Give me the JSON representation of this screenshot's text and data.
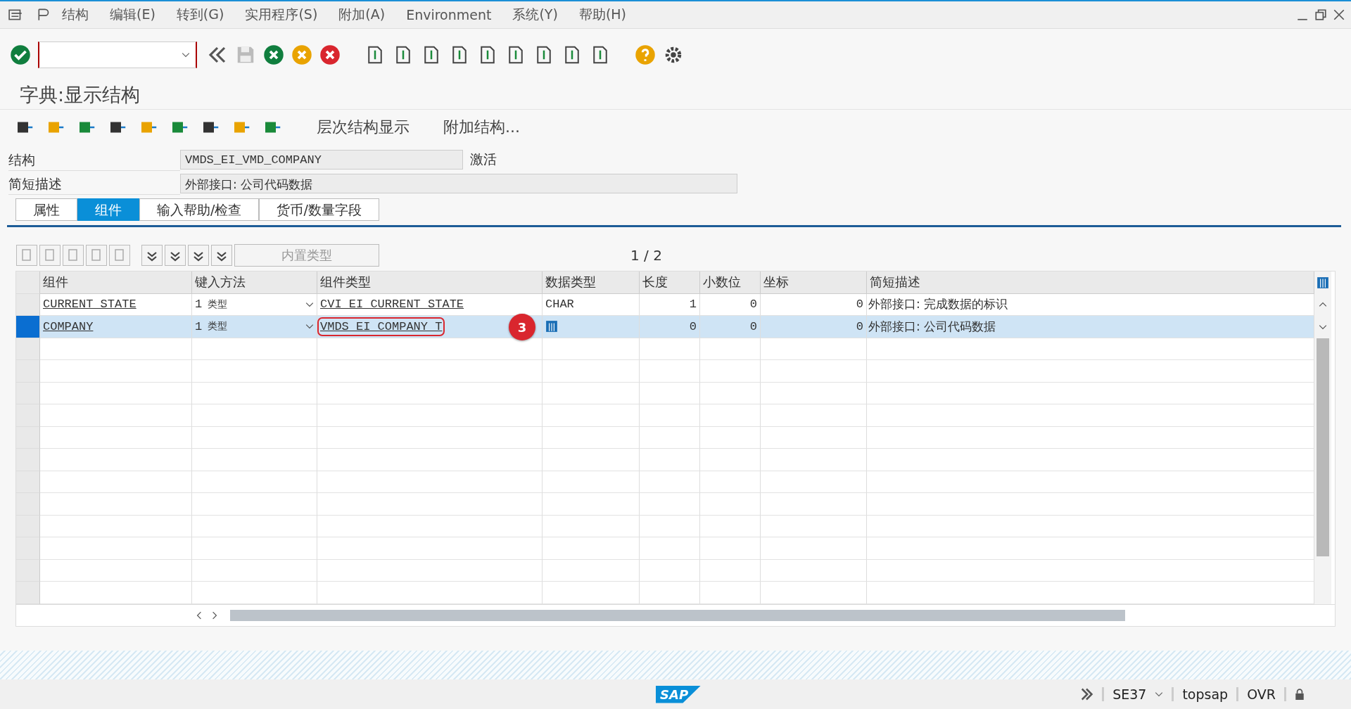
{
  "menu": [
    {
      "label": "结构"
    },
    {
      "label": "编辑(E)"
    },
    {
      "label": "转到(G)"
    },
    {
      "label": "实用程序(S)"
    },
    {
      "label": "附加(A)"
    },
    {
      "label": "Environment"
    },
    {
      "label": "系统(Y)"
    },
    {
      "label": "帮助(H)"
    }
  ],
  "screen_title": "字典:显示结构",
  "app_toolbar": [
    "层次结构显示",
    "附加结构..."
  ],
  "fields": [
    {
      "label": "结构",
      "value": "VMDS_EI_VMD_COMPANY",
      "status": "激活"
    },
    {
      "label": "简短描述",
      "value": "外部接口: 公司代码数据"
    }
  ],
  "tabs": [
    {
      "label": "属性",
      "selected": false
    },
    {
      "label": "组件",
      "selected": true
    },
    {
      "label": "输入帮助/检查",
      "selected": false
    },
    {
      "label": "货币/数量字段",
      "selected": false
    }
  ],
  "table_toolbar": {
    "builtin_type_button": "内置类型",
    "page": "1 / 2"
  },
  "table": {
    "columns": [
      "组件",
      "键入方法",
      "组件类型",
      "数据类型",
      "长度",
      "小数位",
      "坐标",
      "简短描述"
    ],
    "rows": [
      {
        "component": "CURRENT_STATE",
        "method_num": "1",
        "method": "类型",
        "component_type": "CVI_EI_CURRENT_STATE",
        "data_type": "CHAR",
        "length": "1",
        "decimals": "0",
        "coordinate": "0",
        "description": "外部接口: 完成数据的标识",
        "selected": false
      },
      {
        "component": "COMPANY",
        "method_num": "1",
        "method": "类型",
        "component_type": "VMDS_EI_COMPANY_T",
        "length": "0",
        "decimals": "0",
        "coordinate": "0",
        "description": "外部接口: 公司代码数据",
        "selected": true,
        "callout": "3"
      }
    ]
  },
  "status_bar": {
    "logo": "SAP",
    "transaction": "SE37",
    "server": "topsap",
    "mode": "OVR"
  }
}
